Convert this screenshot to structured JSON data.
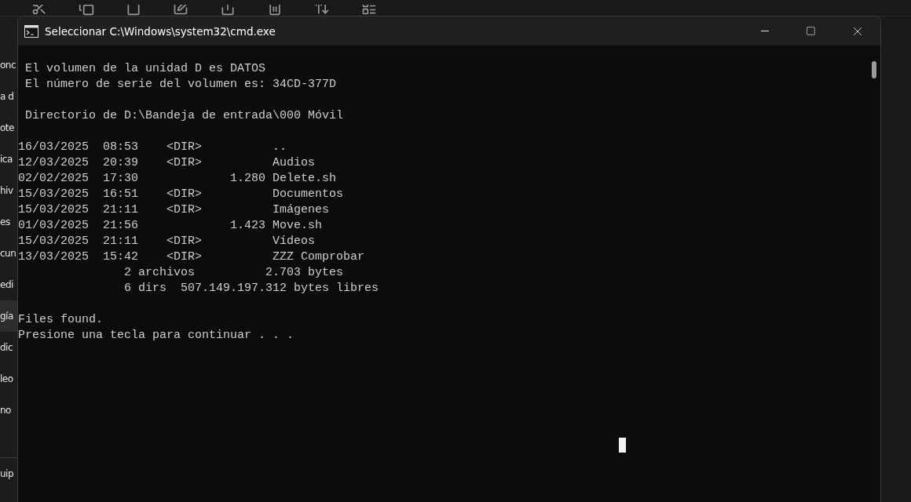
{
  "background_explorer": {
    "sidebar_items": [
      {
        "label": "onc",
        "selected": false
      },
      {
        "label": "a d",
        "selected": false
      },
      {
        "label": "ote",
        "selected": false
      },
      {
        "label": "ica",
        "selected": false
      },
      {
        "label": "hiv",
        "selected": false
      },
      {
        "label": "es",
        "selected": false
      },
      {
        "label": "cun",
        "selected": false
      },
      {
        "label": "edi",
        "selected": false
      },
      {
        "label": "gía",
        "selected": true
      },
      {
        "label": "dic",
        "selected": false
      },
      {
        "label": "leo",
        "selected": false
      },
      {
        "label": "no",
        "selected": false
      },
      {
        "label": "uip",
        "selected": false,
        "kind": "separated"
      }
    ]
  },
  "window": {
    "title": "Seleccionar C:\\Windows\\system32\\cmd.exe",
    "console_blocks": [
      [
        " El volumen de la unidad D es DATOS",
        " El número de serie del volumen es: 34CD-377D"
      ],
      [
        " Directorio de D:\\Bandeja de entrada\\000 Móvil"
      ],
      [
        "16/03/2025  08:53    <DIR>          ..",
        "12/03/2025  20:39    <DIR>          Audios",
        "02/02/2025  17:30             1.280 Delete.sh",
        "15/03/2025  16:51    <DIR>          Documentos",
        "15/03/2025  21:11    <DIR>          Imágenes",
        "01/03/2025  21:56             1.423 Move.sh",
        "15/03/2025  21:11    <DIR>          Vídeos",
        "13/03/2025  15:42    <DIR>          ZZZ Comprobar",
        "               2 archivos          2.703 bytes",
        "               6 dirs  507.149.197.312 bytes libres"
      ],
      [
        "Files found.",
        "Presione una tecla para continuar . . ."
      ]
    ]
  }
}
